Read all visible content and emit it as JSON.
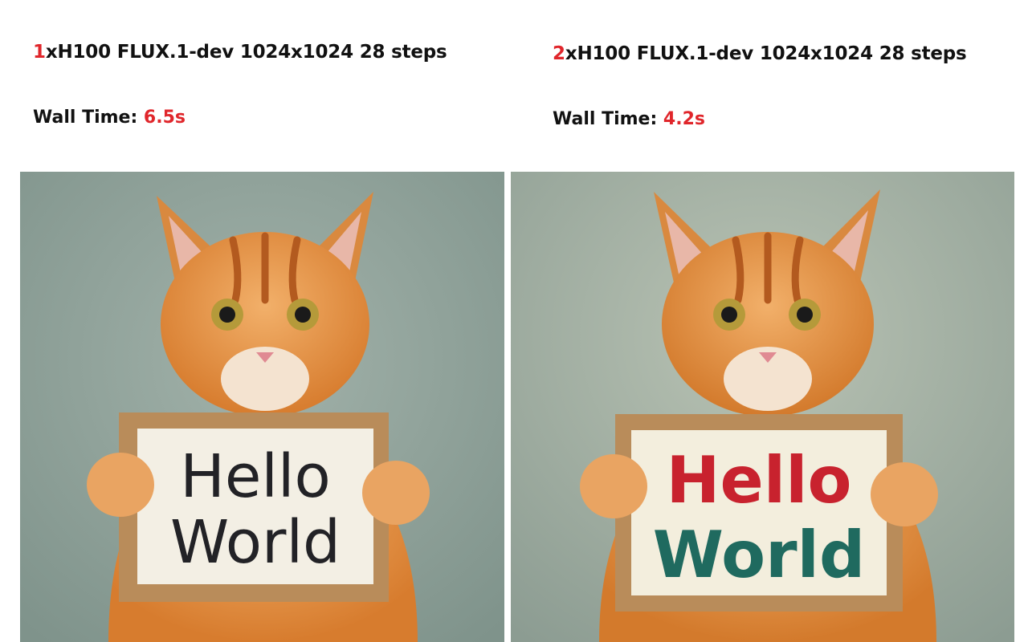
{
  "panels": [
    {
      "gpu_count": "1",
      "config": "xH100 FLUX.1-dev 1024x1024 28 steps",
      "wall_time_label": "Wall Time: ",
      "wall_time_value": "6.5s",
      "sign_line1": "Hello",
      "sign_line2": "World",
      "sign_line1_color": "#222226",
      "sign_line2_color": "#222226",
      "background_color": "#8fa29a"
    },
    {
      "gpu_count": "2",
      "config": "xH100 FLUX.1-dev 1024x1024 28 steps",
      "wall_time_label": "Wall Time: ",
      "wall_time_value": "4.2s",
      "sign_line1": "Hello",
      "sign_line2": "World",
      "sign_line1_color": "#c8222e",
      "sign_line2_color": "#1f6a5f",
      "background_color": "#a7b4a8"
    }
  ],
  "colors": {
    "accent": "#e0262b",
    "text": "#111111"
  }
}
